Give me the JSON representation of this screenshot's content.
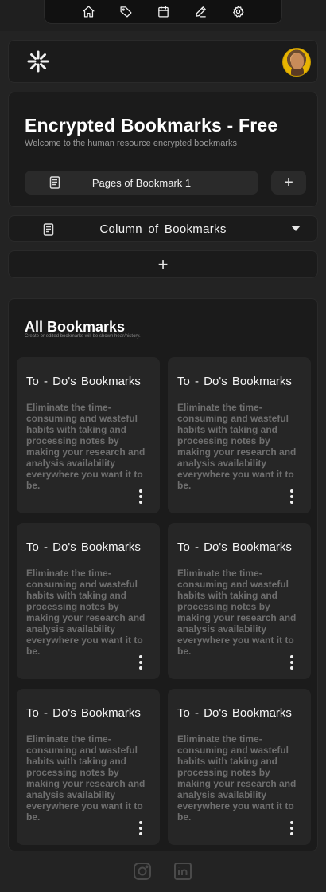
{
  "nav": {
    "icons": [
      "home-icon",
      "tag-icon",
      "calendar-icon",
      "edit-icon",
      "gear-icon"
    ]
  },
  "header": {
    "logo_icon": "asterisk-logo-icon",
    "avatar": "user-avatar"
  },
  "main": {
    "title": "Encrypted Bookmarks - Free",
    "subtitle": "Welcome to the human resource encrypted bookmarks",
    "pages_label": "Pages of Bookmark 1",
    "add_page_label": "+",
    "column_label": "Column  of  Bookmarks",
    "add_column_label": "+"
  },
  "bookmarks": {
    "heading": "All Bookmarks",
    "subheading": "Create or edited bookmarks will be shown hear/history.",
    "items": [
      {
        "title": "To - Do's  Bookmarks",
        "desc": "Eliminate the time-consuming and wasteful habits with taking and processing notes by making your research and analysis availability everywhere you want it to be."
      },
      {
        "title": "To - Do's  Bookmarks",
        "desc": "Eliminate the time-consuming and wasteful habits with taking and processing notes by making your research and analysis availability everywhere you want it to be."
      },
      {
        "title": "To - Do's  Bookmarks",
        "desc": "Eliminate the time-consuming and wasteful habits with taking and processing notes by making your research and analysis availability everywhere you want it to be."
      },
      {
        "title": "To - Do's  Bookmarks",
        "desc": "Eliminate the time-consuming and wasteful habits with taking and processing notes by making your research and analysis availability everywhere you want it to be."
      },
      {
        "title": "To - Do's  Bookmarks",
        "desc": "Eliminate the time-consuming and wasteful habits with taking and processing notes by making your research and analysis availability everywhere you want it to be."
      },
      {
        "title": "To - Do's  Bookmarks",
        "desc": "Eliminate the time-consuming and wasteful habits with taking and processing notes by making your research and analysis availability everywhere you want it to be."
      }
    ]
  },
  "footer": {
    "icons": [
      "instagram-icon",
      "linkedin-icon"
    ]
  },
  "colors": {
    "background": "#232323",
    "card": "#1b1b1b",
    "bookmark_card": "#262626",
    "muted_text": "#6f6f6f"
  }
}
